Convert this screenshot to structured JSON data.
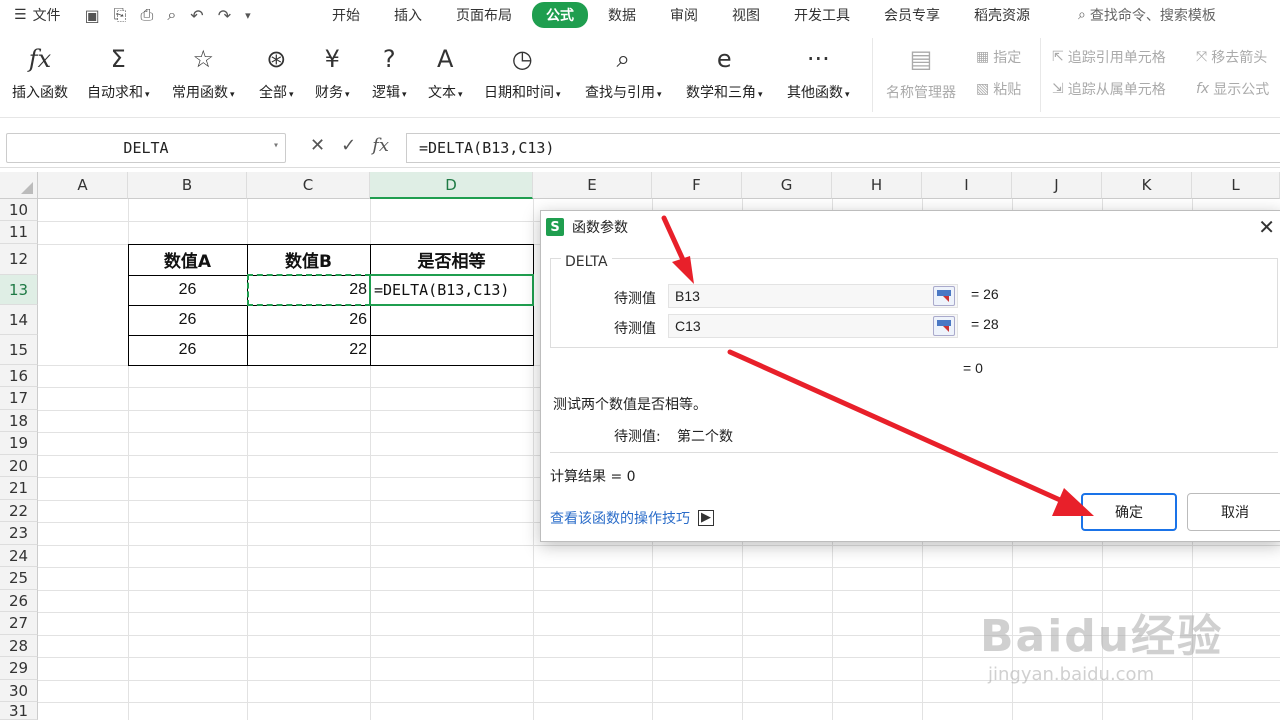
{
  "menubar": {
    "file_label": "文件",
    "tabs": [
      "开始",
      "插入",
      "页面布局",
      "公式",
      "数据",
      "审阅",
      "视图",
      "开发工具",
      "会员专享",
      "稻壳资源"
    ],
    "active_tab": "公式",
    "search_placeholder": "查找命令、搜索模板"
  },
  "ribbon": {
    "insert_function": "插入函数",
    "autosum": "自动求和",
    "common": "常用函数",
    "all": "全部",
    "finance": "财务",
    "logic": "逻辑",
    "text": "文本",
    "datetime": "日期和时间",
    "lookup": "查找与引用",
    "math": "数学和三角",
    "other": "其他函数",
    "name_manager": "名称管理器",
    "define": "指定",
    "paste": "粘贴",
    "trace_precedents": "追踪引用单元格",
    "trace_dependents": "追踪从属单元格",
    "remove_arrows": "移去箭头",
    "show_formulas": "显示公式",
    "icons": {
      "sum": "Σ",
      "star": "☆",
      "all": "⊛",
      "finance": "¥",
      "logic": "?",
      "text": "A",
      "datetime": "◷",
      "lookup": "⌕",
      "math": "e",
      "other": "···"
    }
  },
  "formula_bar": {
    "name_box": "DELTA",
    "formula": "=DELTA(B13,C13)",
    "fx": "fx",
    "cancel": "✕",
    "confirm": "✓"
  },
  "grid": {
    "columns": [
      "A",
      "B",
      "C",
      "D",
      "E",
      "F",
      "G",
      "H",
      "I",
      "J",
      "K",
      "L"
    ],
    "rows": [
      "10",
      "11",
      "12",
      "13",
      "14",
      "15",
      "16",
      "17",
      "18",
      "19",
      "20",
      "21",
      "22",
      "23",
      "24",
      "25",
      "26",
      "27",
      "28",
      "29",
      "30",
      "31"
    ],
    "headers": [
      "数值A",
      "数值B",
      "是否相等"
    ],
    "data": [
      {
        "a": "26",
        "b": "28",
        "d": "=DELTA(B13,C13)"
      },
      {
        "a": "26",
        "b": "26",
        "d": ""
      },
      {
        "a": "26",
        "b": "22",
        "d": ""
      }
    ]
  },
  "dialog": {
    "title": "函数参数",
    "function_name": "DELTA",
    "args": [
      {
        "label": "待测值",
        "value": "B13",
        "result": "= 26"
      },
      {
        "label": "待测值",
        "value": "C13",
        "result": "= 28"
      }
    ],
    "formula_result": "= 0",
    "description": "测试两个数值是否相等。",
    "arg_help_label": "待测值:",
    "arg_help_text": "第二个数",
    "calc_result": "计算结果 = 0",
    "help_link": "查看该函数的操作技巧",
    "ok": "确定",
    "cancel": "取消"
  },
  "watermark": {
    "brand": "Baidu经验",
    "url": "jingyan.baidu.com"
  },
  "colors": {
    "accent": "#1f9e4f",
    "arrow": "#e8202a",
    "link": "#2a6cc9"
  }
}
